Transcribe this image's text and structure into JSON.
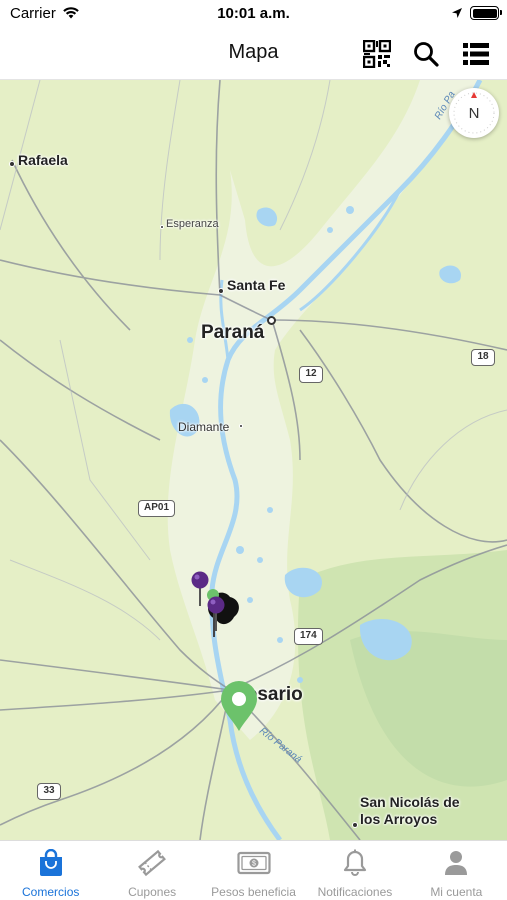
{
  "status_bar": {
    "carrier": "Carrier",
    "time": "10:01 a.m."
  },
  "nav": {
    "title": "Mapa",
    "icons": [
      "qr-code-icon",
      "search-icon",
      "list-icon"
    ]
  },
  "map": {
    "cities": [
      {
        "id": "rafaela",
        "name": "Rafaela"
      },
      {
        "id": "esperanza",
        "name": "Esperanza"
      },
      {
        "id": "santa-fe",
        "name": "Santa Fe"
      },
      {
        "id": "parana",
        "name": "Paraná"
      },
      {
        "id": "diamante",
        "name": "Diamante"
      },
      {
        "id": "rosario",
        "name": "Rosario"
      },
      {
        "id": "san-nicolas",
        "name": "San Nicolás de\nlos Arroyos"
      }
    ],
    "routes": [
      "18",
      "12",
      "AP01",
      "174",
      "33"
    ],
    "rivers": [
      "Río Pa",
      "Río Paraná"
    ],
    "compass": "N",
    "colors": {
      "land": "#e5efc6",
      "water": "#a8d5f2",
      "purple_pin": "#5b2a86",
      "green_pin": "#6cc26b",
      "road": "#8a8f99"
    }
  },
  "tabs": [
    {
      "label": "Comercios",
      "icon": "shopping-bag-icon",
      "active": true
    },
    {
      "label": "Cupones",
      "icon": "ticket-icon",
      "active": false
    },
    {
      "label": "Pesos beneficia",
      "icon": "banknote-icon",
      "active": false
    },
    {
      "label": "Notificaciones",
      "icon": "bell-icon",
      "active": false
    },
    {
      "label": "Mi cuenta",
      "icon": "person-icon",
      "active": false
    }
  ]
}
